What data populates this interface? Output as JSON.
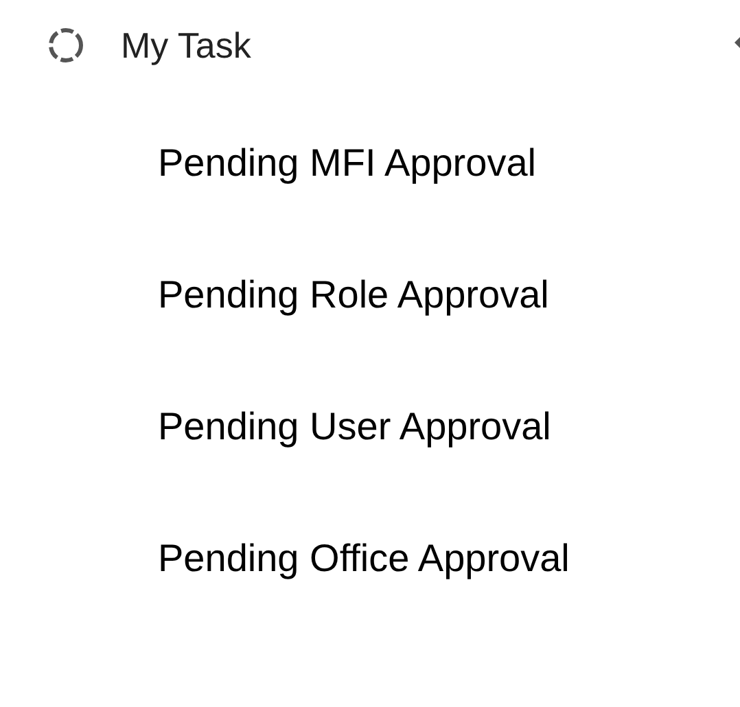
{
  "menu": {
    "title": "My Task",
    "items": [
      {
        "label": "Pending MFI Approval"
      },
      {
        "label": "Pending Role Approval"
      },
      {
        "label": "Pending User Approval"
      },
      {
        "label": "Pending Office Approval"
      }
    ]
  }
}
